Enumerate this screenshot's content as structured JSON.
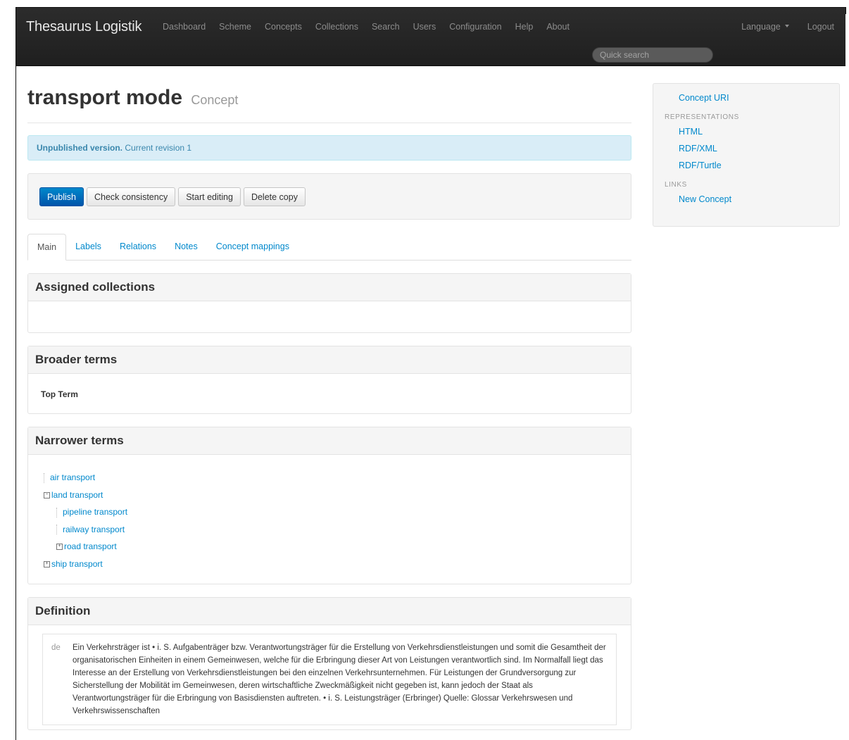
{
  "navbar": {
    "brand": "Thesaurus Logistik",
    "links": [
      "Dashboard",
      "Scheme",
      "Concepts",
      "Collections",
      "Search",
      "Users",
      "Configuration",
      "Help",
      "About"
    ],
    "language_label": "Language",
    "logout_label": "Logout",
    "quick_search_placeholder": "Quick search"
  },
  "page": {
    "title": "transport mode",
    "subtitle": "Concept"
  },
  "alert": {
    "bold": "Unpublished version.",
    "text": "Current revision 1"
  },
  "actions": {
    "publish": "Publish",
    "check": "Check consistency",
    "start_editing": "Start editing",
    "delete_copy": "Delete copy"
  },
  "tabs": [
    "Main",
    "Labels",
    "Relations",
    "Notes",
    "Concept mappings"
  ],
  "assigned_collections": {
    "title": "Assigned collections"
  },
  "broader_terms": {
    "title": "Broader terms",
    "top_term": "Top Term"
  },
  "narrower_terms": {
    "title": "Narrower terms",
    "items": [
      "air transport",
      "land transport",
      "pipeline transport",
      "railway transport",
      "road transport",
      "ship transport"
    ]
  },
  "definition": {
    "title": "Definition",
    "lang": "de",
    "text": "Ein Verkehrsträger ist • i. S. Aufgabenträger bzw. Verantwortungsträger für die Erstellung von Verkehrsdienstleistungen und somit die Gesamtheit der organisatorischen Einheiten in einem Gemeinwesen, welche für die Erbringung dieser Art von Leistungen verantwortlich sind. Im Normalfall liegt das Interesse an der Erstellung von Verkehrsdienstleistungen bei den einzelnen Verkehrsunternehmen. Für Leistungen der Grundversorgung zur Sicherstellung der Mobilität im Gemeinwesen, deren wirtschaftliche Zweckmäßigkeit nicht gegeben ist, kann jedoch der Staat als Verantwortungsträger für die Erbringung von Basisdiensten auftreten. • i. S. Leistungsträger (Erbringer) Quelle: Glossar Verkehrswesen und Verkehrswissenschaften"
  },
  "sidebar": {
    "concept_uri": "Concept URI",
    "representations_header": "REPRESENTATIONS",
    "representations": [
      "HTML",
      "RDF/XML",
      "RDF/Turtle"
    ],
    "links_header": "LINKS",
    "new_concept": "New Concept"
  }
}
